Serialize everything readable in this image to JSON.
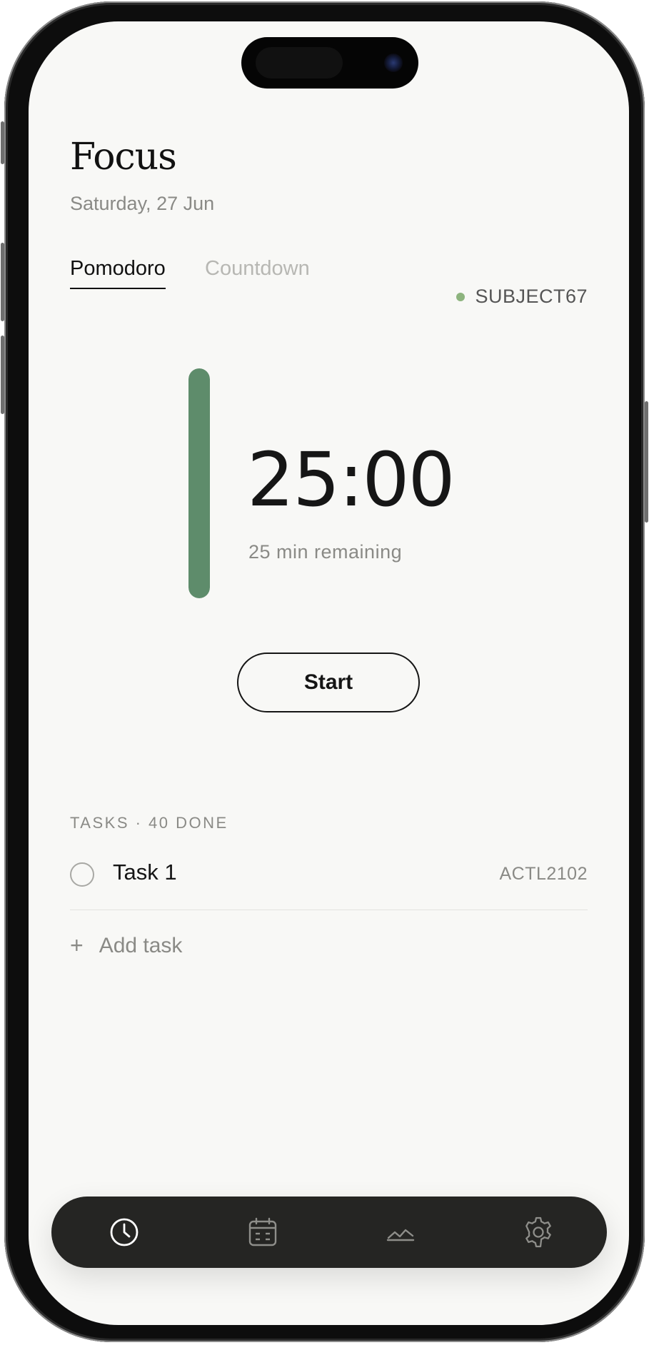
{
  "header": {
    "title": "Focus",
    "date": "Saturday, 27 Jun"
  },
  "tabs": [
    {
      "label": "Pomodoro",
      "active": true
    },
    {
      "label": "Countdown",
      "active": false
    }
  ],
  "subject": {
    "label": "SUBJECT67",
    "color": "#8db47e"
  },
  "timer": {
    "time": "25:00",
    "remaining": "25 min remaining",
    "progress_fraction": 1.0,
    "bar_color": "#5e8c6b",
    "start_label": "Start"
  },
  "tasks": {
    "heading": "TASKS · 40 DONE",
    "items": [
      {
        "name": "Task 1",
        "code": "ACTL2102",
        "done": false
      }
    ],
    "add_label": "Add task"
  },
  "nav": {
    "items": [
      {
        "icon": "clock-icon",
        "active": true
      },
      {
        "icon": "calendar-icon",
        "active": false
      },
      {
        "icon": "stats-chart-icon",
        "active": false
      },
      {
        "icon": "gear-icon",
        "active": false
      }
    ]
  }
}
